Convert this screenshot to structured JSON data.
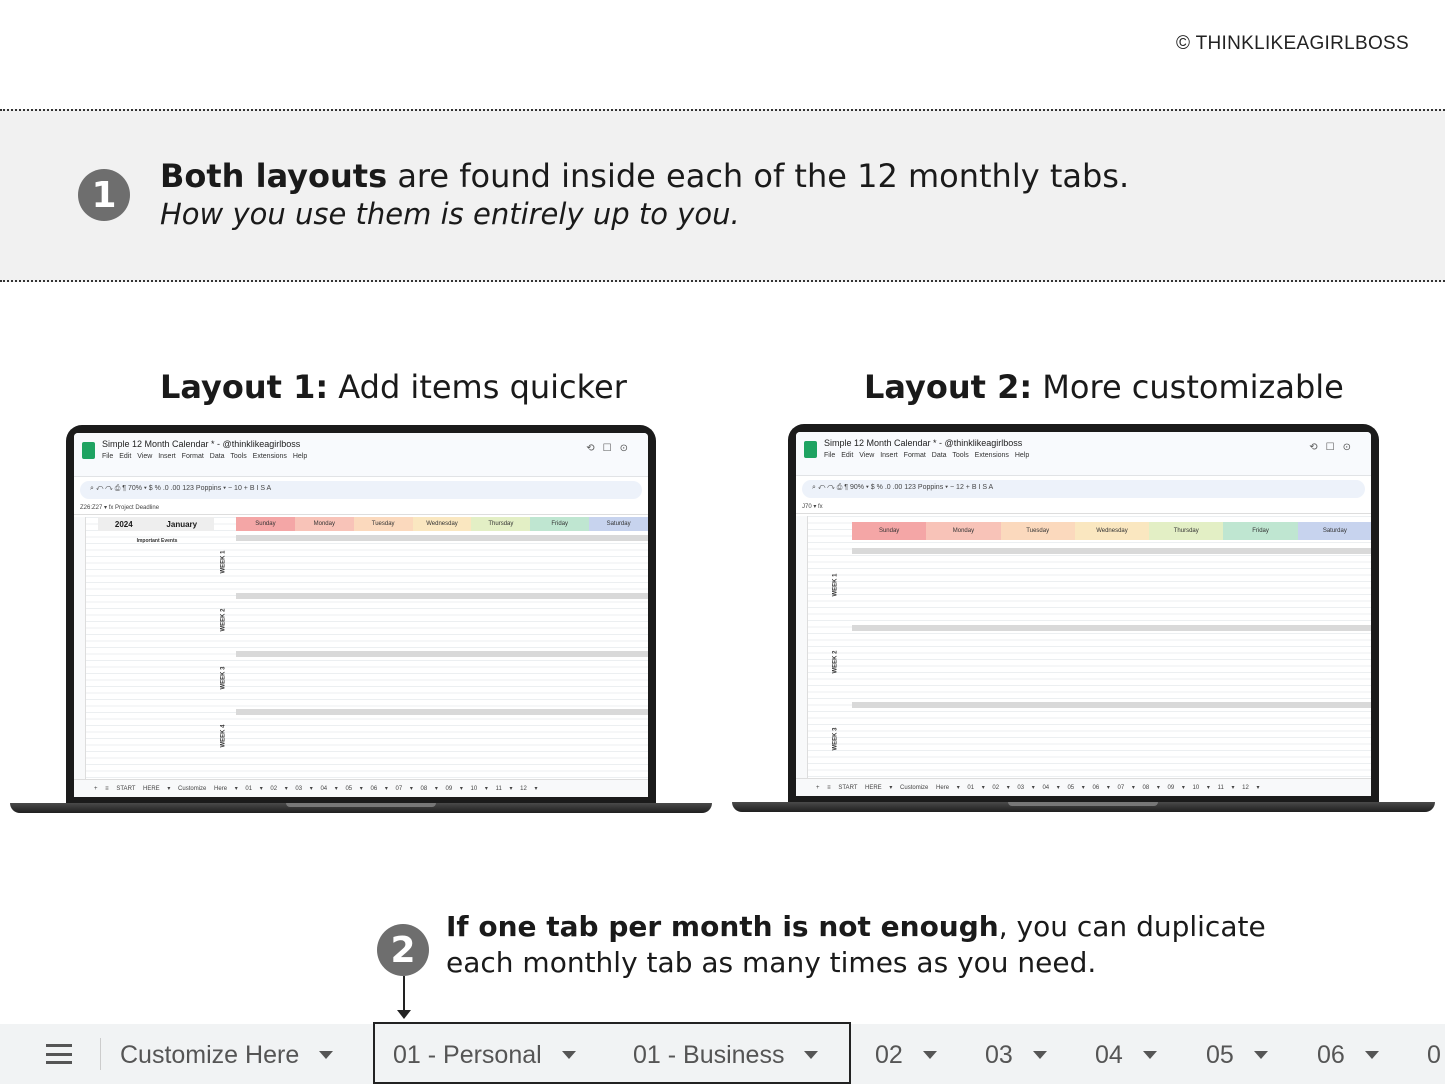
{
  "copyright": "© THINKLIKEAGIRLBOSS",
  "step1": {
    "number": "1",
    "bold": "Both layouts",
    "rest": " are found inside each of the 12 monthly tabs.",
    "italic": "How you use them is entirely up to you."
  },
  "layout1": {
    "bold": "Layout 1:",
    "rest": " Add items quicker"
  },
  "layout2": {
    "bold": "Layout 2:",
    "rest": " More customizable"
  },
  "sheet": {
    "title": "Simple 12 Month Calendar * - @thinklikeagirlboss",
    "menu": "File Edit View Insert Format Data Tools Extensions Help",
    "toolbar1": "⌕  ↶  ↷  ⎙  ¶   70%  ▾   $  %  .0  .00  123   Poppins  ▾   −  10  +   B  I  S  A",
    "toolbar2": "⌕  ↶  ↷  ⎙  ¶   90%  ▾   $  %  .0  .00  123   Poppins  ▾   −  12  +   B  I  S  A",
    "cellref1": "Z26:Z27   ▾   fx  Project Deadline",
    "cellref2": "J70   ▾   fx",
    "year": "2024",
    "month": "January",
    "side_header": "Important Events",
    "tabs1": "+  ≡  START HERE ▾  Customize Here ▾  01 ▾  02 ▾  03 ▾  04 ▾  05 ▾  06 ▾  07 ▾  08 ▾  09 ▾  10 ▾  11 ▾  12 ▾",
    "tabs2": "+  ≡  START HERE ▾  Customize Here ▾  01 ▾  02 ▾  03 ▾  04 ▾  05 ▾  06 ▾  07 ▾  08 ▾  09 ▾  10 ▾  11 ▾  12 ▾",
    "days": [
      "Sunday",
      "Monday",
      "Tuesday",
      "Wednesday",
      "Thursday",
      "Friday",
      "Saturday"
    ],
    "day_colors": [
      "#f4a6a6",
      "#f8c3b8",
      "#fbd9bd",
      "#fae7c0",
      "#e3efc5",
      "#bfe6d1",
      "#c7d3ee"
    ],
    "weeks": [
      "WEEK 1",
      "WEEK 2",
      "WEEK 3",
      "WEEK 4"
    ]
  },
  "step2": {
    "number": "2",
    "bold": "If one tab per month is not enough",
    "rest": ", you can duplicate",
    "line2": "each monthly tab as many times as you need."
  },
  "tabbar": {
    "tabs": [
      "Customize Here",
      "01 - Personal",
      "01 - Business",
      "02",
      "03",
      "04",
      "05",
      "06",
      "0"
    ]
  }
}
